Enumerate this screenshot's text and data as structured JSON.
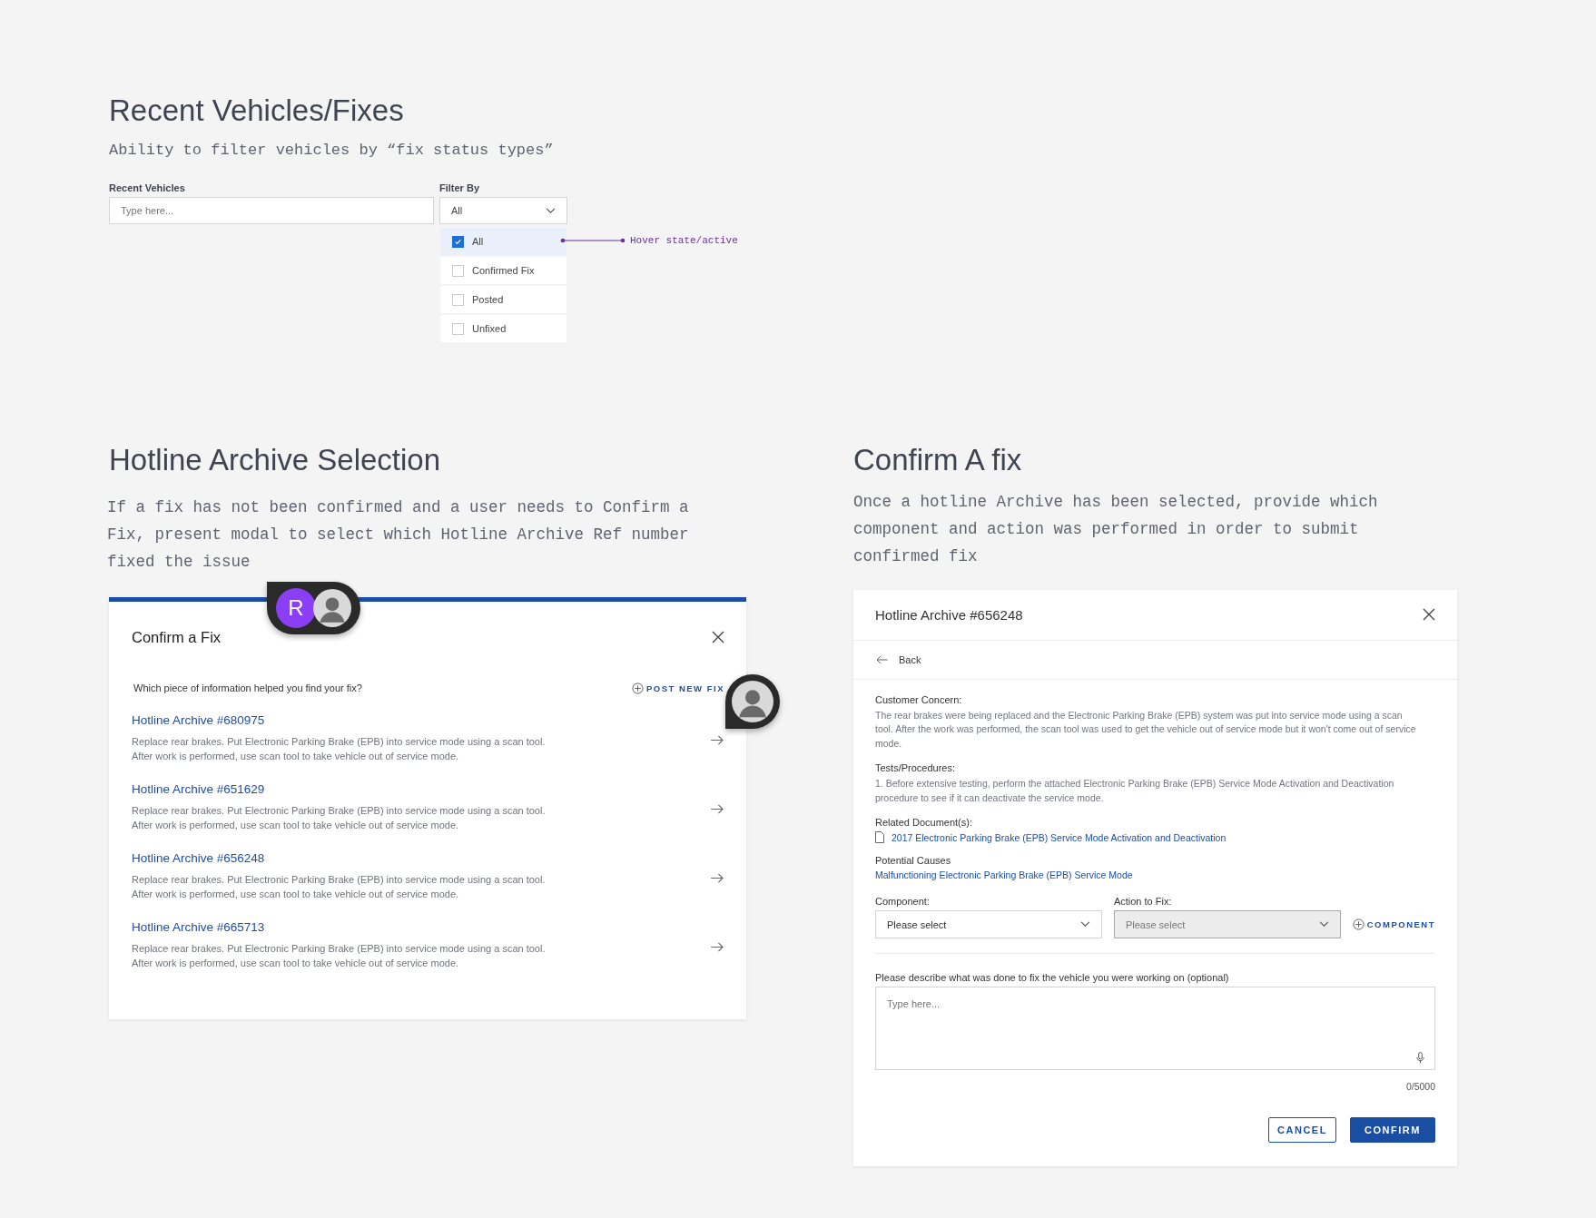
{
  "filter_section": {
    "title": "Recent Vehicles/Fixes",
    "subtitle": "Ability to filter vehicles by “fix status types”",
    "search": {
      "label": "Recent Vehicles",
      "placeholder": "Type here..."
    },
    "filter": {
      "label": "Filter By",
      "value": "All",
      "options": [
        {
          "label": "All",
          "checked": true,
          "selected": true
        },
        {
          "label": "Confirmed Fix",
          "checked": false,
          "selected": false
        },
        {
          "label": "Posted",
          "checked": false,
          "selected": false
        },
        {
          "label": "Unfixed",
          "checked": false,
          "selected": false
        }
      ]
    },
    "annotation": "Hover state/active"
  },
  "archive_section": {
    "title": "Hotline Archive Selection",
    "description": "If a fix has not been confirmed and a user needs to Confirm a Fix, present modal to select which Hotline Archive Ref number fixed the issue",
    "modal": {
      "title": "Confirm a Fix",
      "prompt": "Which piece of information helped you find your fix?",
      "post_button": "POST NEW FIX",
      "items": [
        {
          "title": "Hotline Archive #680975",
          "lines": [
            "Replace rear brakes. Put Electronic Parking Brake (EPB) into service mode using a scan tool.",
            "After work is performed, use scan tool to take vehicle out of service mode."
          ]
        },
        {
          "title": "Hotline Archive #651629",
          "lines": [
            "Replace rear brakes. Put Electronic Parking Brake (EPB) into service mode using a scan tool.",
            "After work is performed, use scan tool to take vehicle out of service mode."
          ]
        },
        {
          "title": "Hotline Archive #656248",
          "lines": [
            "Replace rear brakes. Put Electronic Parking Brake (EPB) into service mode using a scan tool.",
            "After work is performed, use scan tool to take vehicle out of service mode."
          ]
        },
        {
          "title": "Hotline Archive #665713",
          "lines": [
            "Replace rear brakes. Put Electronic Parking Brake (EPB) into service mode using a scan tool.",
            "After work is performed, use scan tool to take vehicle out of service mode."
          ]
        }
      ]
    },
    "presence": [
      {
        "kind": "initial",
        "initial": "R"
      },
      {
        "kind": "photo"
      }
    ],
    "cursor_avatar": {
      "kind": "photo"
    }
  },
  "confirm_section": {
    "title": "Confirm A fix",
    "description": "Once a hotline Archive has been selected, provide which component and action was performed in order to submit confirmed fix",
    "modal": {
      "title": "Hotline Archive #656248",
      "back": "Back",
      "fields": [
        {
          "kind": "text",
          "label": "Customer Concern:",
          "text": "The rear brakes were being replaced and the Electronic Parking Brake (EPB) system was put into service mode using a scan tool. After the work was performed, the scan tool was used to get the vehicle out of service mode but it won't come out of service mode."
        },
        {
          "kind": "text",
          "label": "Tests/Procedures:",
          "text": "1. Before extensive testing, perform the attached Electronic Parking Brake (EPB) Service Mode Activation and Deactivation procedure to see if it can deactivate the service mode."
        },
        {
          "kind": "document",
          "label": "Related Document(s):",
          "text": "2017 Electronic Parking Brake (EPB) Service Mode Activation and Deactivation"
        },
        {
          "kind": "link",
          "label": "Potential Causes",
          "text": "Malfunctioning Electronic Parking Brake (EPB) Service Mode"
        }
      ],
      "selects": [
        {
          "label": "Component:",
          "placeholder": "Please select",
          "disabled": false
        },
        {
          "label": "Action to Fix:",
          "placeholder": "Please select",
          "disabled": true
        }
      ],
      "add_button": "COMPONENT",
      "notes": {
        "label": "Please describe what was done to fix the vehicle you were working on (optional)",
        "placeholder": "Type here...",
        "counter": "0/5000"
      },
      "buttons": [
        {
          "kind": "secondary",
          "label": "CANCEL"
        },
        {
          "kind": "primary",
          "label": "CONFIRM"
        }
      ]
    }
  }
}
